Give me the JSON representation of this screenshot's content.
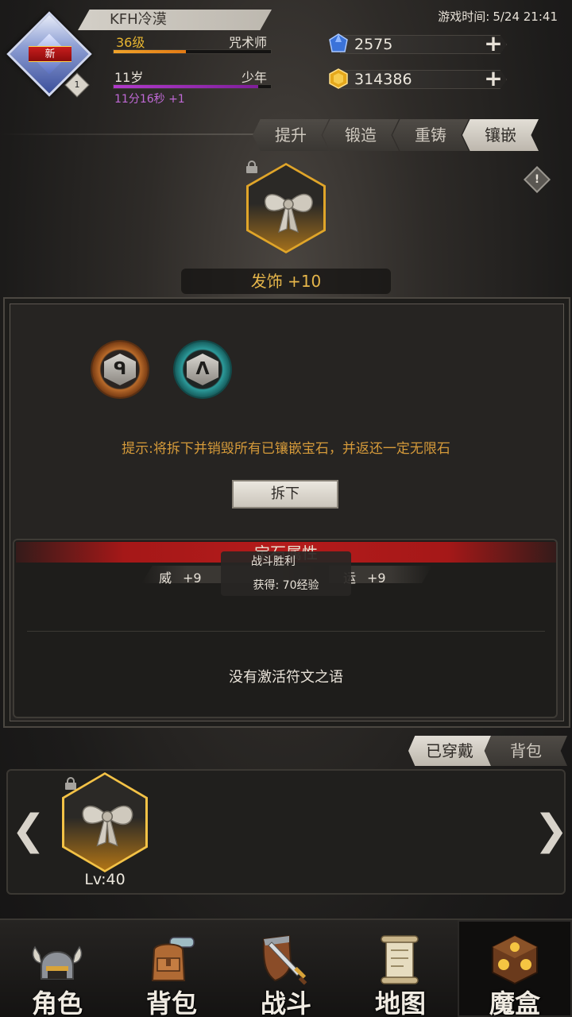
{
  "player": {
    "name": "KFH冷漠",
    "new_badge": "新",
    "rank": "1",
    "level": "36级",
    "class": "咒术师",
    "level_progress": 0.46,
    "age": "11岁",
    "stage": "少年",
    "age_progress": 0.92,
    "time_bonus": "11分16秒 +1"
  },
  "game_time": {
    "label": "游戏时间:",
    "value": "5/24 21:41"
  },
  "currency": {
    "crystal": "2575",
    "gold": "314386"
  },
  "tabs": [
    "提升",
    "锻造",
    "重铸",
    "镶嵌"
  ],
  "active_tab": 3,
  "item": {
    "name": "发饰 +10",
    "warning_icon": "!"
  },
  "sockets": [
    {
      "rune": "ᑫ",
      "color": "#b86a2a"
    },
    {
      "rune": "ᐱ",
      "color": "#2c9a9a"
    }
  ],
  "hint": "提示:将拆下并销毁所有已镶嵌宝石，并返还一定无限石",
  "remove_button": "拆下",
  "gem_attributes": {
    "title": "宝石属性",
    "stats": [
      {
        "name": "威",
        "value": "+9"
      },
      {
        "name": "运",
        "value": "+9"
      }
    ]
  },
  "toast": {
    "title": "战斗胜利",
    "body": "获得: 70经验"
  },
  "rune_status": "没有激活符文之语",
  "inventory": {
    "tabs": [
      "已穿戴",
      "背包"
    ],
    "active_tab": 0,
    "left_arrow": "❮",
    "right_arrow": "❯",
    "item_level": "Lv:40"
  },
  "bottom_nav": [
    "角色",
    "背包",
    "战斗",
    "地图",
    "魔盒"
  ],
  "bottom_nav_active": 4
}
